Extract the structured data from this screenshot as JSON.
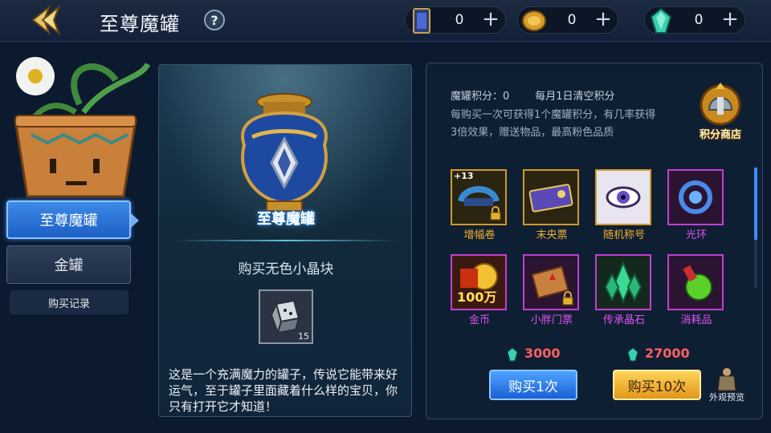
{
  "header": {
    "title": "至尊魔罐",
    "help": "?",
    "resources": [
      {
        "icon": "card-icon",
        "value": "0",
        "add": "+"
      },
      {
        "icon": "coin-icon",
        "value": "0",
        "add": "+"
      },
      {
        "icon": "gem-icon",
        "value": "0",
        "add": "+"
      }
    ]
  },
  "sidebar": {
    "tabs": [
      {
        "label": "至尊魔罐",
        "active": true
      },
      {
        "label": "金罐",
        "active": false
      }
    ],
    "record": "购买记录"
  },
  "jar_panel": {
    "jar_name": "至尊魔罐",
    "buy_item": "购买无色小晶块",
    "crystal_count": "15",
    "description": "这是一个充满魔力的罐子，传说它能带来好运气，至于罐子里面藏着什么样的宝贝，你只有打开它才知道！"
  },
  "shop_panel": {
    "score_label": "魔罐积分：0",
    "reset_note": "每月1日清空积分",
    "info": "每购买一次可获得1个魔罐积分，有几率获得3倍效果，赠送物品，最高粉色品质",
    "shop_label": "积分商店",
    "items": [
      {
        "label": "增幅卷",
        "rarity": "orange",
        "badge": "+13",
        "locked": true
      },
      {
        "label": "末央票",
        "rarity": "orange",
        "locked": false
      },
      {
        "label": "随机称号",
        "rarity": "orange",
        "locked": false
      },
      {
        "label": "光环",
        "rarity": "purple",
        "locked": false
      },
      {
        "label": "金币",
        "rarity": "purple",
        "badge": "100万",
        "locked": false
      },
      {
        "label": "小胖门票",
        "rarity": "purple",
        "locked": true
      },
      {
        "label": "传承晶石",
        "rarity": "purple",
        "locked": false
      },
      {
        "label": "消耗品",
        "rarity": "purple",
        "locked": false
      }
    ],
    "price_single": "3000",
    "price_ten": "27000",
    "buy_single": "购买1次",
    "buy_ten": "购买10次",
    "preview": "外观预览"
  },
  "colors": {
    "orange_rarity": "#f0b030",
    "purple_rarity": "#e050f0",
    "price": "#ff6060",
    "active_tab": "#2f7be0"
  }
}
